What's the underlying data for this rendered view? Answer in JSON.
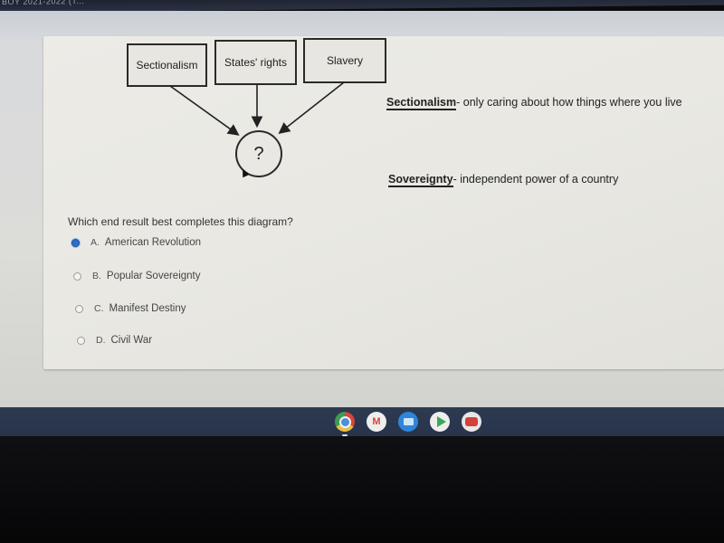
{
  "window": {
    "title_fragment": "BOY 2021-2022 (T..."
  },
  "diagram": {
    "causes": [
      "Sectionalism",
      "States' rights",
      "Slavery"
    ],
    "result_placeholder": "?"
  },
  "definitions": [
    {
      "term": "Sectionalism",
      "text": "- only caring about how things where you live"
    },
    {
      "term": "Sovereignty",
      "text": "- independent power of a country"
    }
  ],
  "question": {
    "prompt": "Which end result best completes this diagram?",
    "options": [
      {
        "letter": "A.",
        "label": "American Revolution",
        "selected": true
      },
      {
        "letter": "B.",
        "label": "Popular Sovereignty",
        "selected": false
      },
      {
        "letter": "C.",
        "label": "Manifest Destiny",
        "selected": false
      },
      {
        "letter": "D.",
        "label": "Civil War",
        "selected": false
      }
    ]
  },
  "shelf": {
    "apps": [
      "chrome-icon",
      "gmail-icon",
      "files-icon",
      "play-store-icon",
      "youtube-icon"
    ],
    "gmail_glyph": "M"
  }
}
